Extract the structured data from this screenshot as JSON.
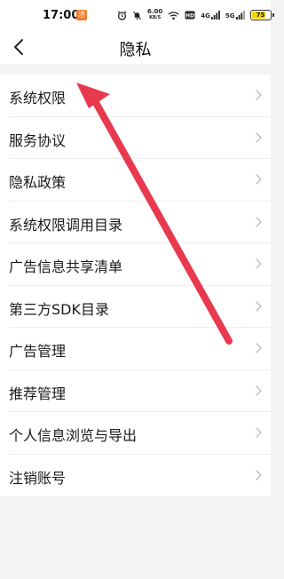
{
  "status_bar": {
    "time": "17:00",
    "app_badge": "活",
    "net_speed_value": "6.00",
    "net_speed_unit": "KB/S",
    "sim1_label": "4G",
    "sim2_label": "5G",
    "battery_level": "75",
    "battery_color": "#f2d600"
  },
  "header": {
    "title": "隐私",
    "back_icon": "chevron-left-icon"
  },
  "menu": {
    "items": [
      {
        "label": "系统权限"
      },
      {
        "label": "服务协议"
      },
      {
        "label": "隐私政策"
      },
      {
        "label": "系统权限调用目录"
      },
      {
        "label": "广告信息共享清单"
      },
      {
        "label": "第三方SDK目录"
      },
      {
        "label": "广告管理"
      },
      {
        "label": "推荐管理"
      },
      {
        "label": "个人信息浏览与导出"
      },
      {
        "label": "注销账号"
      }
    ],
    "chevron_icon": "chevron-right-icon"
  },
  "annotation": {
    "color": "#e8394f"
  }
}
